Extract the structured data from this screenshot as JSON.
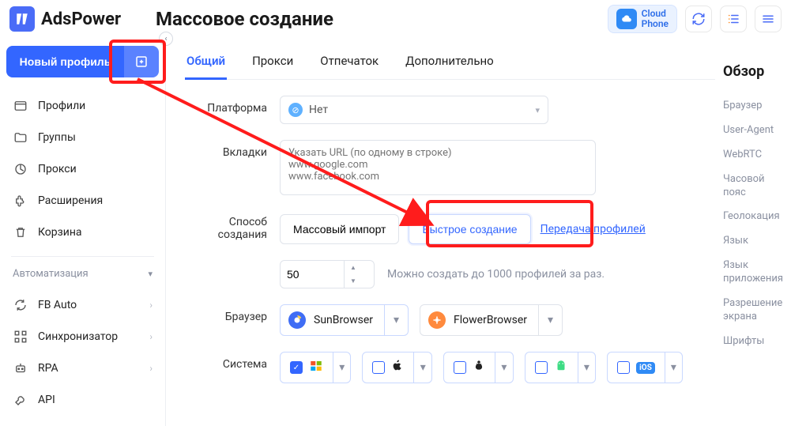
{
  "app": {
    "name": "AdsPower",
    "page_title": "Массовое создание",
    "cloud_phone": "Cloud\nPhone"
  },
  "sidebar": {
    "new_profile": "Новый профиль",
    "items": [
      {
        "label": "Профили",
        "icon": "window"
      },
      {
        "label": "Группы",
        "icon": "folder"
      },
      {
        "label": "Прокси",
        "icon": "globe-clock"
      },
      {
        "label": "Расширения",
        "icon": "puzzle"
      },
      {
        "label": "Корзина",
        "icon": "trash"
      }
    ],
    "section": "Автоматизация",
    "auto_items": [
      {
        "label": "FB Auto",
        "icon": "refresh"
      },
      {
        "label": "Синхронизатор",
        "icon": "sync-grid"
      },
      {
        "label": "RPA",
        "icon": "robot"
      },
      {
        "label": "API",
        "icon": "wrench"
      }
    ]
  },
  "tabs": [
    {
      "id": "general",
      "label": "Общий",
      "active": true
    },
    {
      "id": "proxy",
      "label": "Прокси"
    },
    {
      "id": "fingerprint",
      "label": "Отпечаток"
    },
    {
      "id": "advanced",
      "label": "Дополнительно"
    }
  ],
  "form": {
    "platform_label": "Платформа",
    "platform_value": "Нет",
    "tabs_label": "Вкладки",
    "tabs_placeholder": "Указать URL (по одному в строке)\nwww.google.com\nwww.facebook.com",
    "method_label": "Способ создания",
    "method_options": {
      "mass": "Массовый импорт",
      "quick": "Быстрое создание",
      "transfer": "Передача профилей"
    },
    "quantity": "50",
    "quantity_hint": "Можно создать до 1000 профилей за раз.",
    "browser_label": "Браузер",
    "browsers": {
      "sun": "SunBrowser",
      "flower": "FlowerBrowser"
    },
    "system_label": "Система",
    "systems": [
      "windows",
      "apple",
      "linux",
      "android",
      "ios"
    ]
  },
  "right": {
    "title": "Обзор",
    "items": [
      "Браузер",
      "User-Agent",
      "WebRTC",
      "Часовой пояс",
      "Геолокация",
      "Язык",
      "Язык приложения",
      "Разрешение экрана",
      "Шрифты"
    ]
  }
}
